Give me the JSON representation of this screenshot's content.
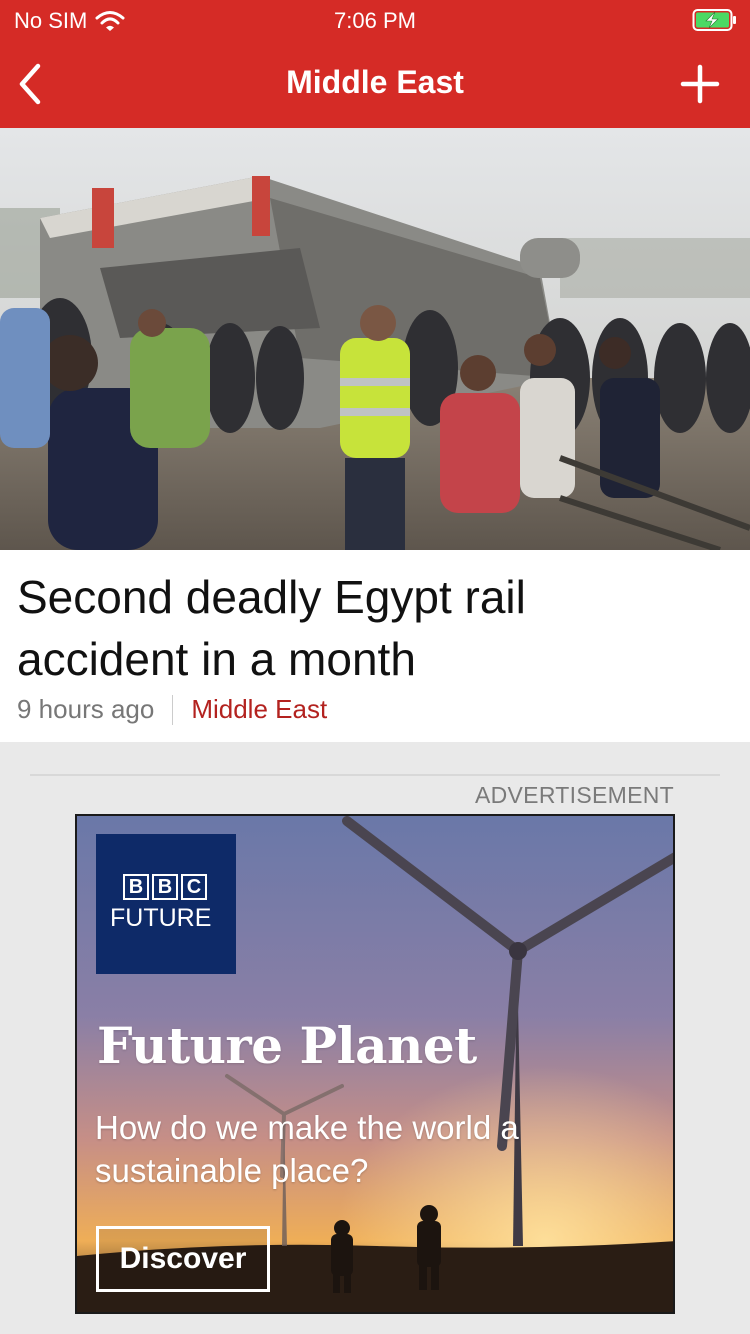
{
  "status_bar": {
    "carrier": "No SIM",
    "time": "7:06 PM"
  },
  "nav": {
    "title": "Middle East",
    "back_icon": "chevron-left-icon",
    "add_icon": "plus-icon"
  },
  "article": {
    "headline": "Second deadly Egypt rail accident in a month",
    "time_ago": "9 hours ago",
    "section": "Middle East"
  },
  "ad": {
    "label": "ADVERTISEMENT",
    "brand_letters": [
      "B",
      "B",
      "C"
    ],
    "brand_name": "FUTURE",
    "headline": "Future Planet",
    "subtitle": "How do we make the world a sustainable place?",
    "button_label": "Discover"
  },
  "colors": {
    "brand_red": "#d52b26",
    "section_link": "#b3221f",
    "bbc_blue": "#0e2a68"
  }
}
